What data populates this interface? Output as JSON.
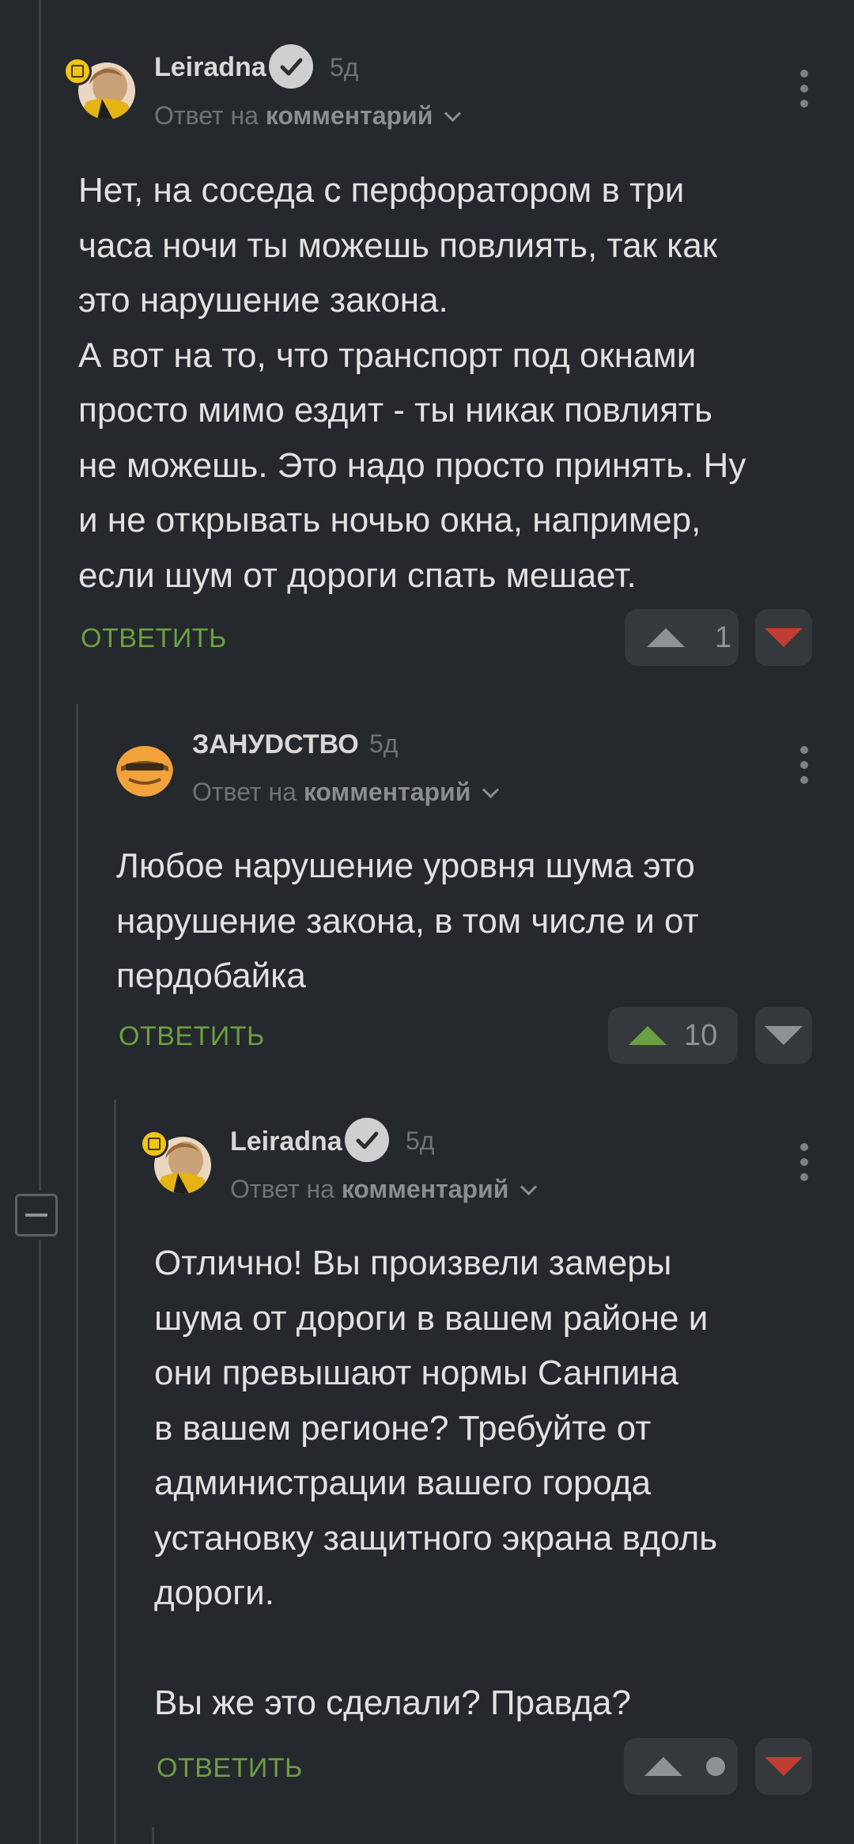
{
  "comments": [
    {
      "author": "Leiradna",
      "time": "5д",
      "reply_prefix": "Ответ на",
      "reply_target": "комментарий",
      "text": "Нет, на соседа с перфоратором в три\nчаса ночи ты можешь повлиять, так как\nэто нарушение закона.\nА вот на то, что транспорт под окнами\nпросто мимо ездит - ты никак повлиять\nне можешь. Это надо просто принять. Ну\nи не открывать ночью окна, например,\nесли шум от дороги спать мешает.",
      "reply_label": "ОТВЕТИТЬ",
      "score": "1"
    },
    {
      "author": "ЗАНУDСТВО",
      "time": "5д",
      "reply_prefix": "Ответ на",
      "reply_target": "комментарий",
      "text": "Любое нарушение уровня шума это\nнарушение закона, в том числе и от\nпердобайка",
      "reply_label": "ОТВЕТИТЬ",
      "score": "10"
    },
    {
      "author": "Leiradna",
      "time": "5д",
      "reply_prefix": "Ответ на",
      "reply_target": "комментарий",
      "text": "Отлично! Вы произвели замеры\nшума от дороги в вашем районе и\nони превышают нормы Санпина\nв вашем регионе? Требуйте от\nадминистрации вашего города\nустановку защитного экрана вдоль\nдороги.\n\nВы же это сделали? Правда?",
      "reply_label": "ОТВЕТИТЬ",
      "score": ""
    }
  ],
  "colors": {
    "background": "#25282c",
    "reply_green": "#6aa042",
    "downvote_red": "#bf3d33",
    "muted": "#6f7378"
  },
  "icons": [
    "verified-check-icon",
    "chevron-down-icon",
    "more-vertical-icon",
    "upvote-arrow-icon",
    "downvote-arrow-icon",
    "collapse-minus-icon",
    "community-badge-icon"
  ]
}
